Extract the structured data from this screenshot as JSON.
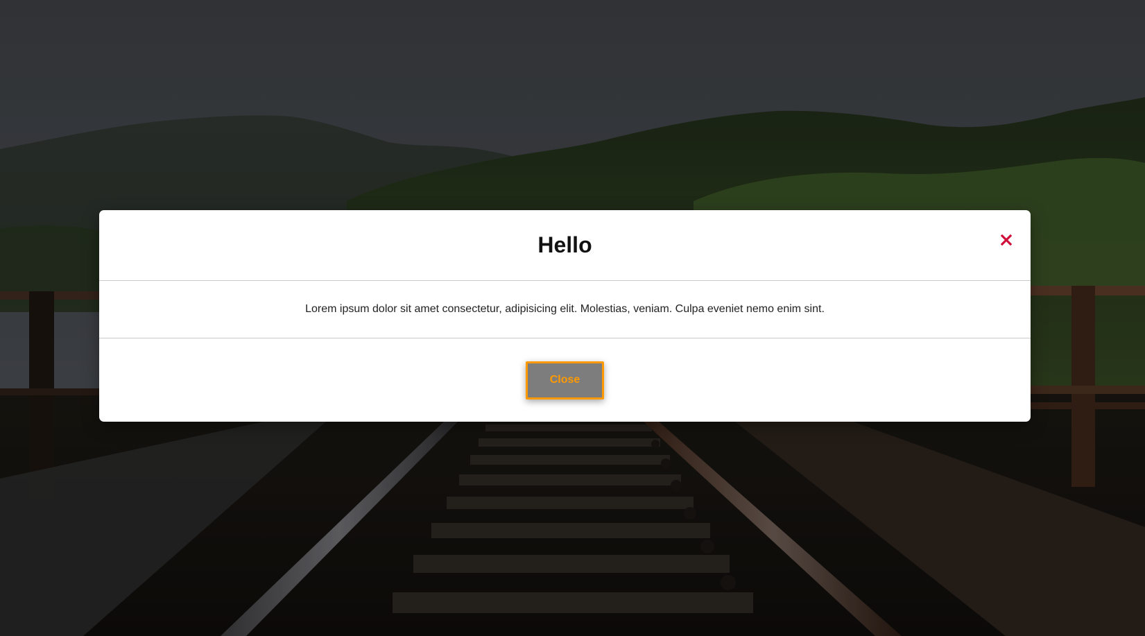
{
  "modal": {
    "title": "Hello",
    "body_text": "Lorem ipsum dolor sit amet consectetur, adipisicing elit. Molestias, veniam. Culpa eveniet nemo enim sint.",
    "close_icon": "close-x-icon",
    "close_button_label": "Close"
  },
  "colors": {
    "close_icon": "#d0103a",
    "button_accent": "#ff9900",
    "button_bg": "#7d7d7d",
    "modal_bg": "#ffffff"
  },
  "background": {
    "scene": "railway bridge photo"
  }
}
